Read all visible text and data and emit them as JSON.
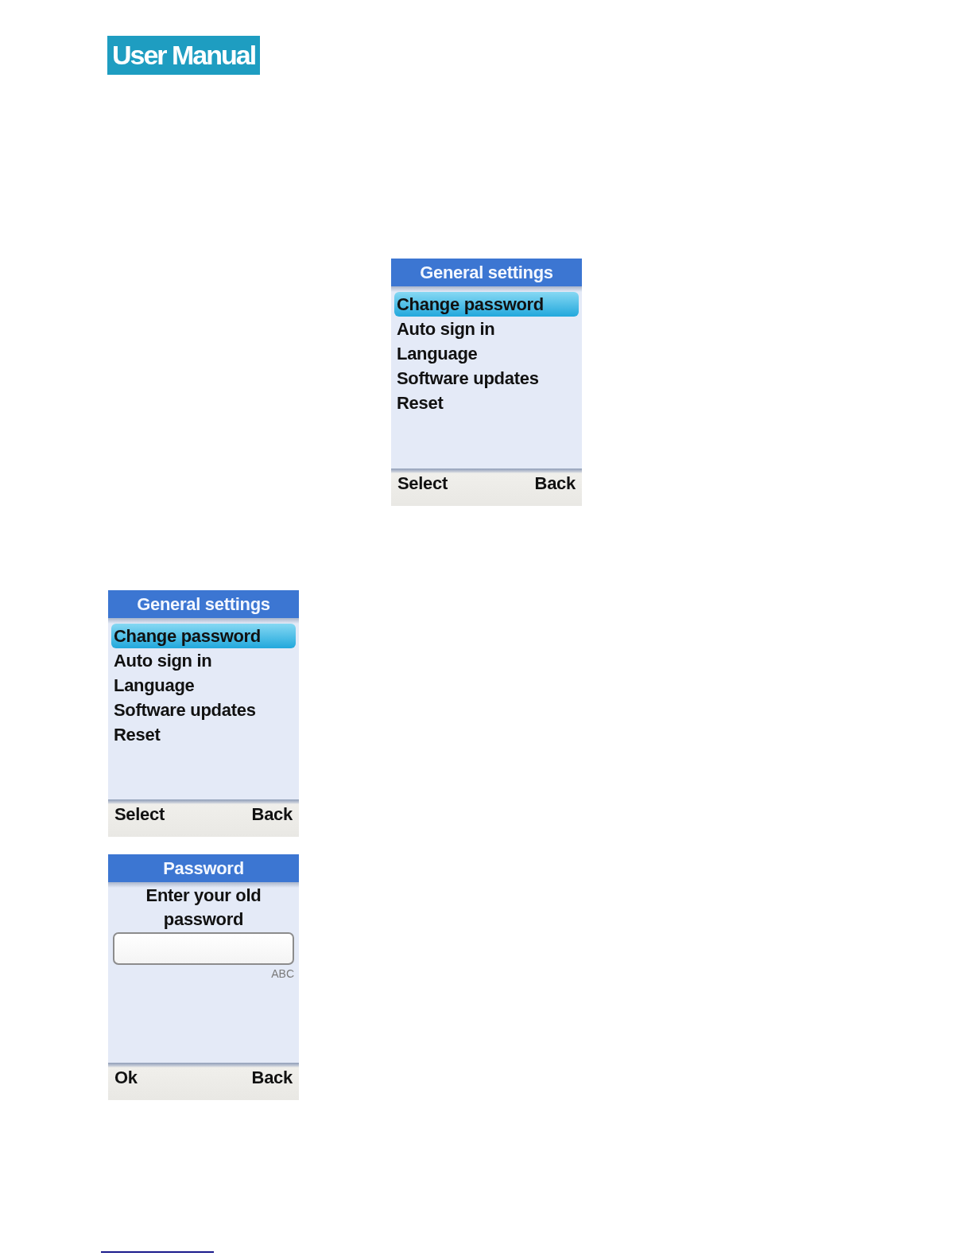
{
  "header": {
    "title": "User Manual"
  },
  "screens": [
    {
      "kind": "menu",
      "title": "General settings",
      "items": [
        {
          "label": "Change password",
          "selected": true
        },
        {
          "label": "Auto sign in",
          "selected": false
        },
        {
          "label": "Language",
          "selected": false
        },
        {
          "label": "Software updates",
          "selected": false
        },
        {
          "label": "Reset",
          "selected": false
        }
      ],
      "softkeys": {
        "left": "Select",
        "right": "Back"
      }
    },
    {
      "kind": "menu",
      "title": "General settings",
      "items": [
        {
          "label": "Change password",
          "selected": true
        },
        {
          "label": "Auto sign in",
          "selected": false
        },
        {
          "label": "Language",
          "selected": false
        },
        {
          "label": "Software updates",
          "selected": false
        },
        {
          "label": "Reset",
          "selected": false
        }
      ],
      "softkeys": {
        "left": "Select",
        "right": "Back"
      }
    },
    {
      "kind": "input",
      "title": "Password",
      "prompt": "Enter your old password",
      "input_mode": "ABC",
      "softkeys": {
        "left": "Ok",
        "right": "Back"
      }
    }
  ]
}
